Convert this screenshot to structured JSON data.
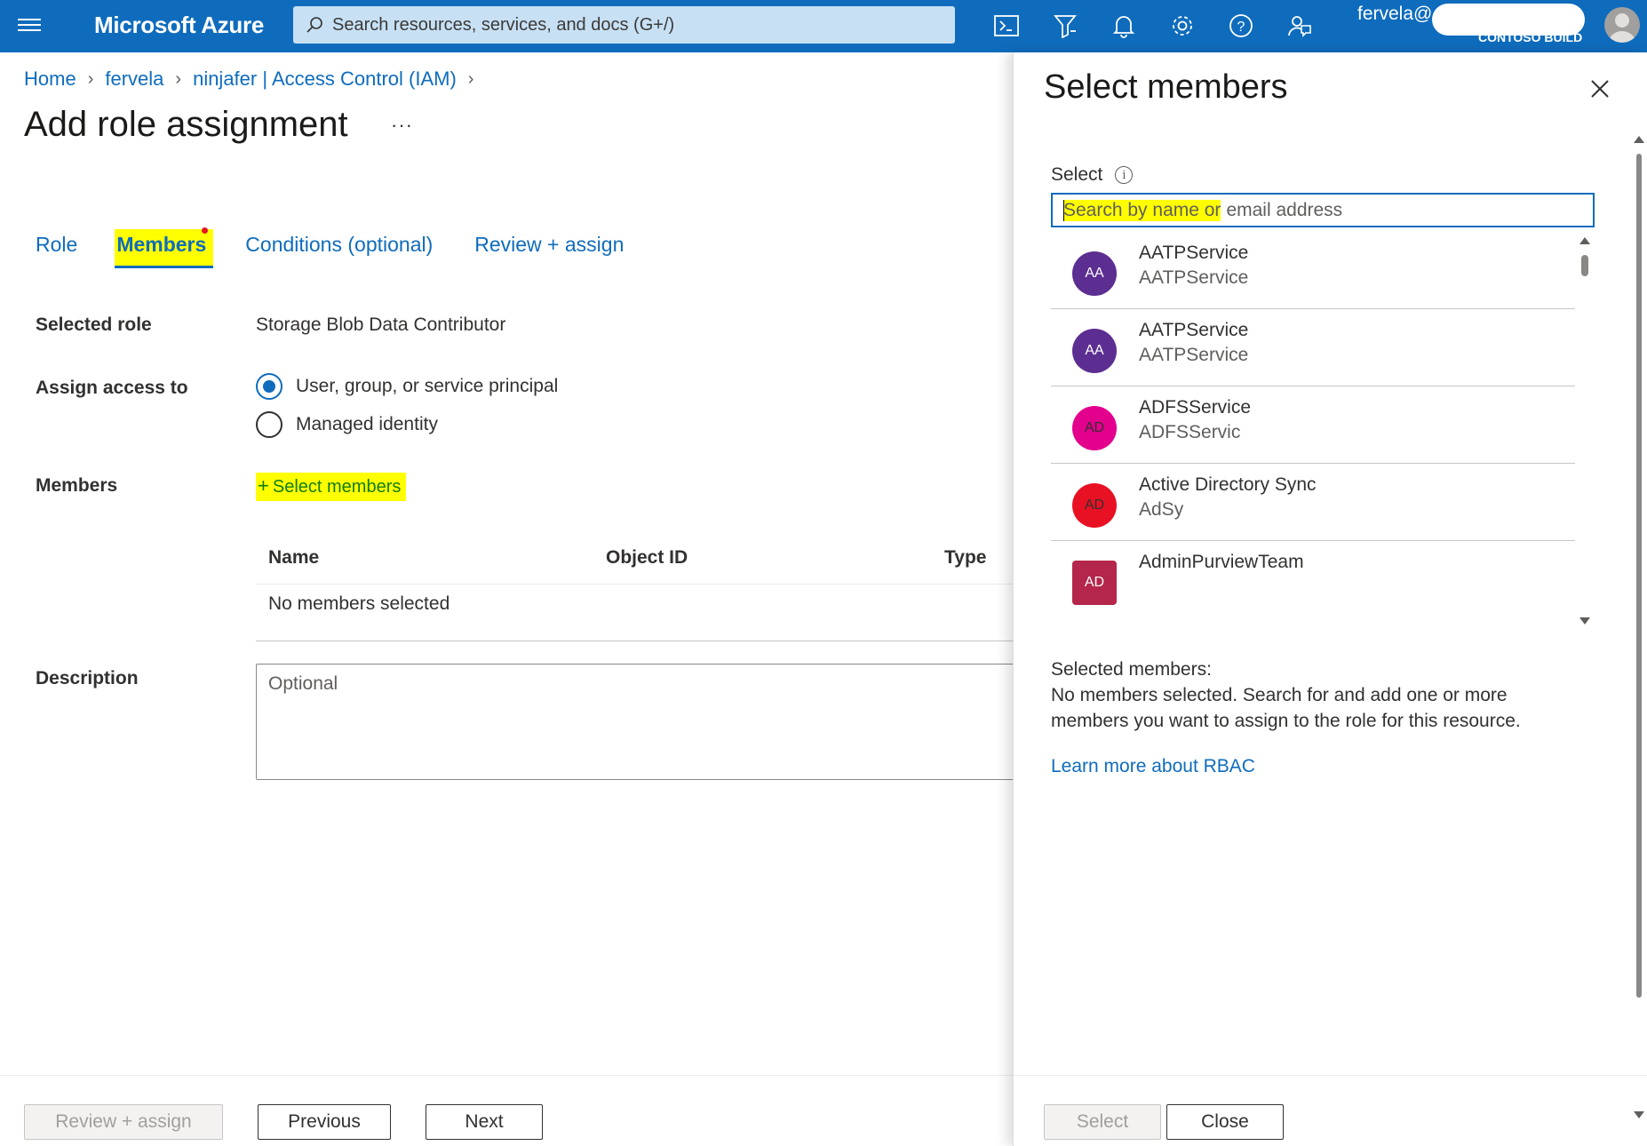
{
  "topbar": {
    "brand": "Microsoft Azure",
    "search_placeholder": "Search resources, services, and docs (G+/)",
    "user_name": "fervela@",
    "user_suffix": "··",
    "tenant": "CONTOSO BUILD",
    "icons": [
      "cloud-shell-icon",
      "directory-filter-icon",
      "notifications-icon",
      "settings-icon",
      "help-icon",
      "feedback-icon"
    ]
  },
  "breadcrumb": {
    "items": [
      "Home",
      "fervela",
      "ninjafer | Access Control (IAM)"
    ]
  },
  "page": {
    "title": "Add role assignment",
    "more": "···"
  },
  "tabs": [
    "Role",
    "Members",
    "Conditions (optional)",
    "Review + assign"
  ],
  "form": {
    "selected_role_label": "Selected role",
    "selected_role_value": "Storage Blob Data Contributor",
    "assign_access_label": "Assign access to",
    "assign_options": [
      "User, group, or service principal",
      "Managed identity"
    ],
    "members_label": "Members",
    "select_members_link": "Select members",
    "table_headers": [
      "Name",
      "Object ID",
      "Type"
    ],
    "table_empty": "No members selected",
    "description_label": "Description",
    "description_placeholder": "Optional"
  },
  "footer": {
    "review_assign": "Review + assign",
    "previous": "Previous",
    "next": "Next"
  },
  "panel": {
    "title": "Select members",
    "select_label": "Select",
    "search_placeholder_highlighted": "Search by name or",
    "search_placeholder_rest": "email address",
    "items": [
      {
        "initials": "AA",
        "name": "AATPService",
        "sub": "AATPService",
        "color": "#5c2e91"
      },
      {
        "initials": "AA",
        "name": "AATPService",
        "sub": "AATPService",
        "color": "#5c2e91"
      },
      {
        "initials": "AD",
        "name": "ADFSService",
        "sub": "ADFSServic",
        "color": "#e3008c"
      },
      {
        "initials": "AD",
        "name": "Active Directory Sync",
        "sub": "AdSy",
        "color": "#e81123"
      },
      {
        "initials": "AD",
        "name": "AdminPurviewTeam",
        "sub": "",
        "color": "#b4264b"
      }
    ],
    "selected_members_heading": "Selected members:",
    "selected_members_text": "No members selected. Search for and add one or more members you want to assign to the role for this resource.",
    "learn_more": "Learn more about RBAC",
    "select_button": "Select",
    "close_button": "Close"
  }
}
